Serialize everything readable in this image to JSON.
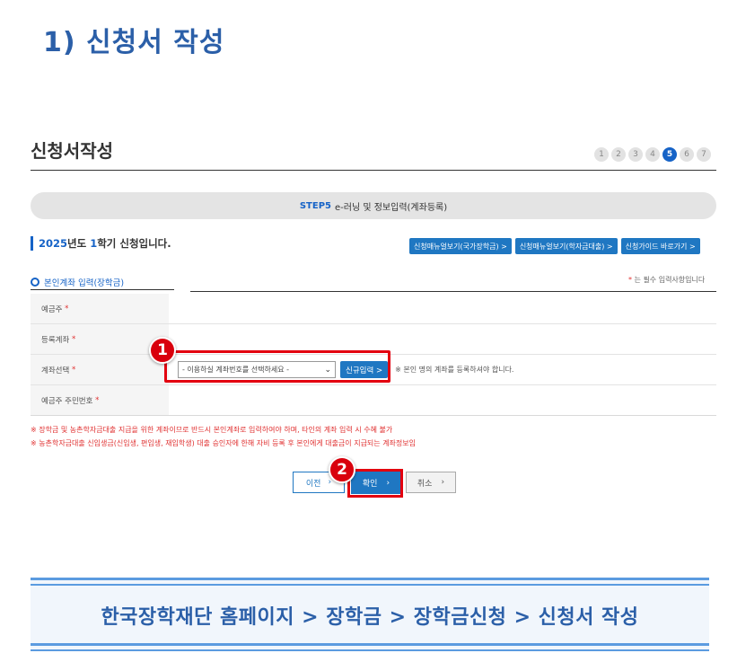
{
  "page_heading": "1) 신청서 작성",
  "form_title": "신청서작성",
  "steps": [
    "1",
    "2",
    "3",
    "4",
    "5",
    "6",
    "7"
  ],
  "active_step": "5",
  "step_bar": {
    "tag": "STEP5",
    "text": "e-러닝 및 정보입력(계좌등록)"
  },
  "semester_notice": {
    "year": "2025",
    "year_suffix": "년도 ",
    "term": "1",
    "term_suffix": "학기 신청입니다."
  },
  "guide_buttons": [
    "신청매뉴얼보기(국가장학금) >",
    "신청매뉴얼보기(학자금대출) >",
    "신청가이드 바로가기 >"
  ],
  "section_title": "본인계좌 입력(장학금)",
  "required_note": {
    "star": "*",
    "text": " 는 필수 입력사항입니다"
  },
  "form_rows": [
    {
      "label": "예금주",
      "required": "*"
    },
    {
      "label": "등록계좌",
      "required": "*"
    },
    {
      "label": "계좌선택",
      "required": "*"
    },
    {
      "label": "예금주 주민번호",
      "required": "*"
    }
  ],
  "account_select": {
    "value": "- 이용하실 계좌번호를 선택하세요 -",
    "chevron": "⌄"
  },
  "new_input_button": "신규입력 >",
  "account_hint": "※ 본인 명의 계좌를 등록하셔야 합니다.",
  "warnings": [
    "※ 장학금 및 농촌학자금대출 지급을 위한 계좌이므로 반드시 본인계좌로 입력하여야 하며, 타인의 계좌 입력 시 수혜 불가",
    "※ 농촌학자금대출 신입생금(신입생, 편입생, 재입학생) 대출 승인자에 한해 자비 등록 후 본인에게 대출금이 지급되는 계좌정보임"
  ],
  "buttons": {
    "prev": "이전",
    "confirm": "확인",
    "cancel": "취소",
    "arrow": "›"
  },
  "badges": [
    "1",
    "2"
  ],
  "breadcrumb": "한국장학재단 홈페이지 > 장학금 > 장학금신청 > 신청서 작성",
  "colors": {
    "accent": "#1f77c2",
    "heading": "#2b5fa8",
    "highlight": "#e3000f"
  }
}
